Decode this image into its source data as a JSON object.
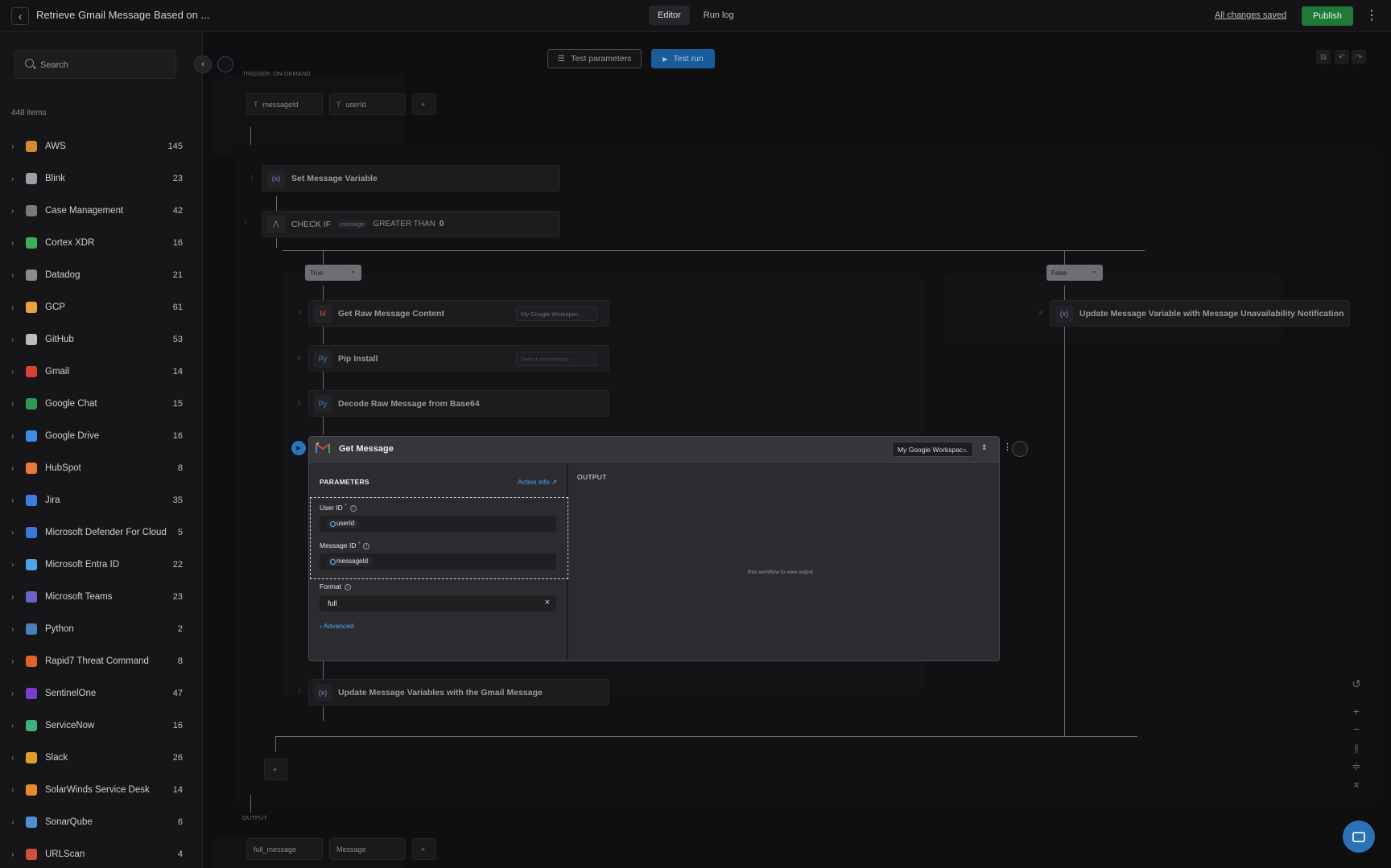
{
  "header": {
    "title": "Retrieve Gmail Message Based on ...",
    "tabs": [
      {
        "label": "Editor",
        "active": true
      },
      {
        "label": "Run log",
        "active": false
      }
    ],
    "status": "All changes saved",
    "publish_label": "Publish"
  },
  "sidebar": {
    "search_placeholder": "Search",
    "items_count": "448 items",
    "apps": [
      {
        "name": "AWS",
        "count": "145",
        "color": "#d48a2a"
      },
      {
        "name": "Blink",
        "count": "23",
        "color": "#9aa0a6"
      },
      {
        "name": "Case Management",
        "count": "42",
        "color": "#7a7a7a"
      },
      {
        "name": "Cortex XDR",
        "count": "16",
        "color": "#3fae5a"
      },
      {
        "name": "Datadog",
        "count": "21",
        "color": "#8a8a8a"
      },
      {
        "name": "GCP",
        "count": "61",
        "color": "#e9a33b"
      },
      {
        "name": "GitHub",
        "count": "53",
        "color": "#bdbdbd"
      },
      {
        "name": "Gmail",
        "count": "14",
        "color": "#d84234"
      },
      {
        "name": "Google Chat",
        "count": "15",
        "color": "#2f9a55"
      },
      {
        "name": "Google Drive",
        "count": "16",
        "color": "#3d8be2"
      },
      {
        "name": "HubSpot",
        "count": "8",
        "color": "#e8793d"
      },
      {
        "name": "Jira",
        "count": "35",
        "color": "#3d7fe0"
      },
      {
        "name": "Microsoft Defender For Cloud",
        "count": "5",
        "color": "#3b78d8"
      },
      {
        "name": "Microsoft Entra ID",
        "count": "22",
        "color": "#4fa3e8"
      },
      {
        "name": "Microsoft Teams",
        "count": "23",
        "color": "#6b64c8"
      },
      {
        "name": "Python",
        "count": "2",
        "color": "#4a80b8"
      },
      {
        "name": "Rapid7 Threat Command",
        "count": "8",
        "color": "#e0612e"
      },
      {
        "name": "SentinelOne",
        "count": "47",
        "color": "#7a3fd0"
      },
      {
        "name": "ServiceNow",
        "count": "16",
        "color": "#3fb07a"
      },
      {
        "name": "Slack",
        "count": "26",
        "color": "#e0a030"
      },
      {
        "name": "SolarWinds Service Desk",
        "count": "14",
        "color": "#e88a2a"
      },
      {
        "name": "SonarQube",
        "count": "6",
        "color": "#4d8fd0"
      },
      {
        "name": "URLScan",
        "count": "4",
        "color": "#d0503a"
      }
    ]
  },
  "canvas": {
    "test_parameters_label": "Test parameters",
    "test_run_label": "Test run",
    "trigger_label": "TRIGGER: ON-DEMAND",
    "trigger_params": [
      "messageId",
      "userId"
    ],
    "output_label": "OUTPUT",
    "output_params": [
      "full_message",
      "Message"
    ],
    "steps": [
      {
        "num": "1",
        "title": "Set Message Variable"
      },
      {
        "num": "2",
        "title": "CHECK IF",
        "token": "message",
        "op": "GREATER THAN",
        "value": "0"
      },
      {
        "num": "3",
        "title": "Get Raw Message Content",
        "connection": "My Google Workspac..."
      },
      {
        "num": "4",
        "title": "Pip Install",
        "connection": "Select connection"
      },
      {
        "num": "5",
        "title": "Decode Raw Message from Base64"
      },
      {
        "num": "7",
        "title": "Update Message Variables with the Gmail Message"
      },
      {
        "num": "8",
        "title": "Update Message Variable with Message Unavailability Notification"
      }
    ],
    "branches": {
      "true_label": "True",
      "false_label": "False"
    }
  },
  "card": {
    "title": "Get Message",
    "connection": "My Google Workspac...",
    "params_label": "PARAMETERS",
    "action_info": "Action info",
    "user_id_label": "User ID",
    "user_id_value": "userId",
    "message_id_label": "Message ID",
    "message_id_value": "messageId",
    "format_label": "Format",
    "format_value": "full",
    "advanced_label": "Advanced",
    "output_label": "OUTPUT",
    "output_empty": "Run workflow to view output"
  }
}
